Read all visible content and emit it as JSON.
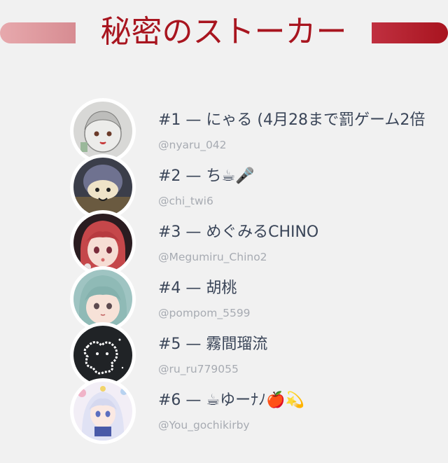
{
  "header": {
    "title": "秘密のストーカー"
  },
  "colors": {
    "accent": "#a8151f",
    "accent_light": "#e7a9ad",
    "name_text": "#3a4558",
    "handle_text": "#a7abb2",
    "background": "#f1f1f1"
  },
  "entries": [
    {
      "name": "#1 — にゃる (4月28まで罰ゲーム2倍",
      "handle": "@nyaru_042",
      "avatar_icon": "avatar-drawn-girl-icon"
    },
    {
      "name": "#2 — ち☕🎤",
      "handle": "@chi_twi6",
      "avatar_icon": "avatar-plush-icon"
    },
    {
      "name": "#3 — めぐみるCHINO",
      "handle": "@Megumiru_Chino2",
      "avatar_icon": "avatar-red-hair-girl-icon"
    },
    {
      "name": "#4 — 胡桃",
      "handle": "@pompom_5599",
      "avatar_icon": "avatar-green-hair-girl-icon"
    },
    {
      "name": "#5 — 霧間瑠流",
      "handle": "@ru_ru779055",
      "avatar_icon": "avatar-light-drawing-icon"
    },
    {
      "name": "#6 — ☕ゆーﾅﾉ🍎💫",
      "handle": "@You_gochikirby",
      "avatar_icon": "avatar-white-hair-girl-icon"
    }
  ]
}
